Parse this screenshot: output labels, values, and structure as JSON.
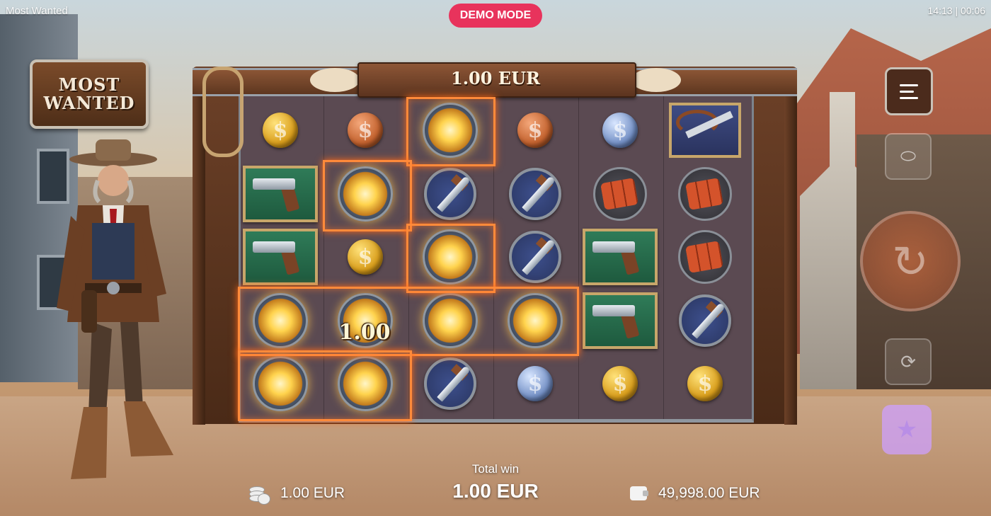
{
  "top_bar": {
    "game_title": "Most Wanted",
    "mode_badge": "DEMO MODE",
    "clock": "14:13 | 00:06"
  },
  "logo": {
    "line1": "MOST",
    "line2": "WANTED"
  },
  "board": {
    "bet_sign": "1.00 EUR",
    "win_amount_label": "1.00",
    "columns": 6,
    "rows": 5,
    "grid": [
      [
        "gold-coin-icon",
        "copper-coin-icon",
        "whiskey-bottle-icon",
        "copper-coin-icon",
        "silver-coin-icon",
        "rifle-icon"
      ],
      [
        "revolver-icon",
        "whiskey-bottle-icon",
        "knife-icon",
        "knife-icon",
        "dynamite-icon",
        "dynamite-icon"
      ],
      [
        "revolver-icon",
        "gold-coin-icon",
        "whiskey-bottle-icon",
        "knife-icon",
        "revolver-icon",
        "dynamite-icon"
      ],
      [
        "whiskey-bottle-icon",
        "whiskey-bottle-icon",
        "whiskey-bottle-icon",
        "whiskey-bottle-icon",
        "revolver-icon",
        "knife-icon"
      ],
      [
        "whiskey-bottle-icon",
        "whiskey-bottle-icon",
        "knife-icon",
        "silver-coin-icon",
        "gold-coin-icon",
        "gold-coin-icon"
      ]
    ]
  },
  "controls": {
    "menu": "menu-icon",
    "autoplay": "autoplay-toggle-icon",
    "spin": "spin-icon",
    "turbo": "turbo-icon",
    "bonus": "star-icon"
  },
  "bottom_bar": {
    "bet_value": "1.00 EUR",
    "total_win_label": "Total win",
    "total_win_value": "1.00 EUR",
    "balance_value": "49,998.00 EUR"
  },
  "colors": {
    "demo_badge": "#e8335c",
    "win_highlight": "#ff8a3a",
    "bonus_button": "#cea0ff"
  }
}
